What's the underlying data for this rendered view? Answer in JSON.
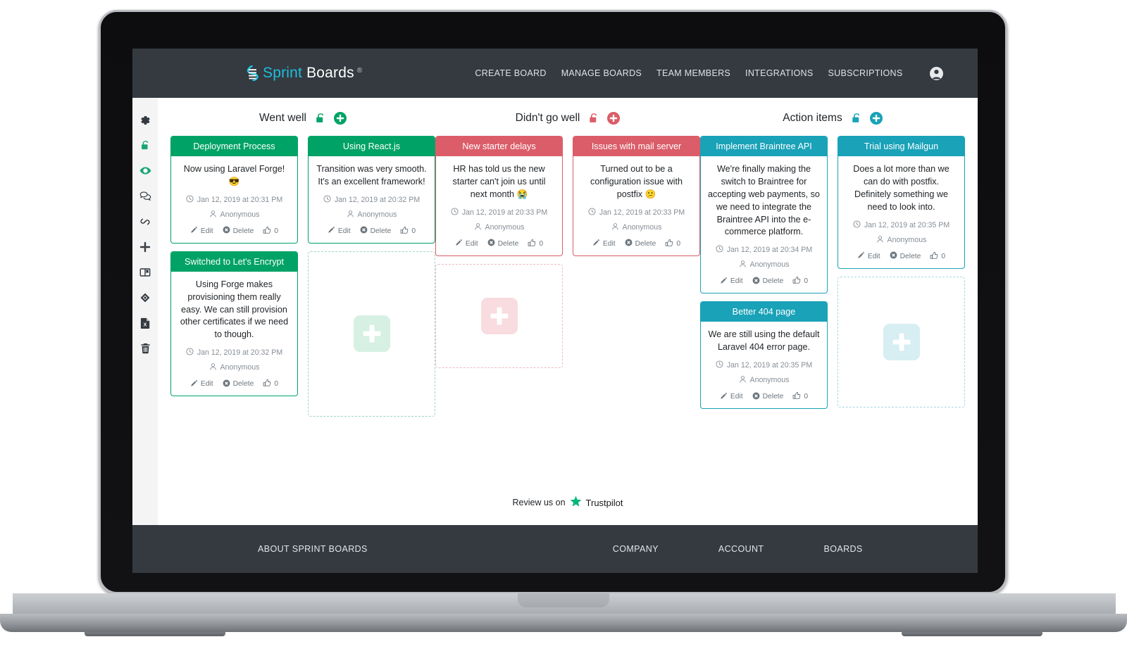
{
  "navbar": {
    "brand": {
      "sprint": "Sprint",
      "boards": "Boards",
      "registered": "®"
    },
    "links": [
      {
        "label": "CREATE BOARD",
        "name": "nav-create-board"
      },
      {
        "label": "MANAGE BOARDS",
        "name": "nav-manage-boards"
      },
      {
        "label": "TEAM MEMBERS",
        "name": "nav-team-members"
      },
      {
        "label": "INTEGRATIONS",
        "name": "nav-integrations"
      },
      {
        "label": "SUBSCRIPTIONS",
        "name": "nav-subscriptions"
      }
    ],
    "avatar_icon": "user-circle-icon"
  },
  "sidebar": {
    "items": [
      {
        "icon": "gear-icon",
        "color": "#343a40"
      },
      {
        "icon": "unlock-icon",
        "color": "#17a673"
      },
      {
        "icon": "eye-icon",
        "color": "#17a673"
      },
      {
        "icon": "comments-icon",
        "color": "#343a40"
      },
      {
        "icon": "link-icon",
        "color": "#343a40"
      },
      {
        "icon": "slack-icon",
        "color": "#343a40"
      },
      {
        "icon": "book-icon",
        "color": "#343a40"
      },
      {
        "icon": "sketch-icon",
        "color": "#343a40"
      },
      {
        "icon": "file-excel-icon",
        "color": "#343a40"
      },
      {
        "icon": "trash-icon",
        "color": "#343a40"
      }
    ]
  },
  "colors": {
    "green": "#00a365",
    "green_border": "#00a365",
    "red": "#db5d69",
    "red_border": "#db5d69",
    "teal": "#19a2b8",
    "teal_border": "#19a2b8",
    "navy": "#343a40",
    "brand_cyan": "#20bedd"
  },
  "board": {
    "columns": [
      {
        "title": "Went well",
        "accent": "#00a365",
        "placeholder_fill": "#d6f0e4",
        "placeholder_border": "#9bd9c0",
        "lock_icon": "unlock-icon",
        "add_icon": "plus-circle-icon",
        "stacks": [
          {
            "cards": [
              {
                "title": "Deployment Process",
                "text": "Now using Laravel Forge! 😎",
                "time": "Jan 12, 2019 at 20:31 PM",
                "author": "Anonymous",
                "edit": "Edit",
                "delete": "Delete",
                "likes": "0"
              },
              {
                "title": "Switched to Let's Encrypt",
                "text": "Using Forge makes provisioning them really easy. We can still provision other certificates if we need to though.",
                "time": "Jan 12, 2019 at 20:32 PM",
                "author": "Anonymous",
                "edit": "Edit",
                "delete": "Delete",
                "likes": "0"
              }
            ],
            "placeholder": false
          },
          {
            "cards": [
              {
                "title": "Using React.js",
                "text": "Transition was very smooth. It's an excellent framework!",
                "time": "Jan 12, 2019 at 20:32 PM",
                "author": "Anonymous",
                "edit": "Edit",
                "delete": "Delete",
                "likes": "0"
              }
            ],
            "placeholder": true,
            "placeholder_height": 235
          }
        ]
      },
      {
        "title": "Didn't go well",
        "accent": "#db5d69",
        "placeholder_fill": "#f8dcdf",
        "placeholder_border": "#efb9bf",
        "lock_icon": "unlock-icon",
        "add_icon": "plus-circle-icon",
        "stacks": [
          {
            "cards": [
              {
                "title": "New starter delays",
                "text": "HR has told us the new starter can't join us until next month 😭",
                "time": "Jan 12, 2019 at 20:33 PM",
                "author": "Anonymous",
                "edit": "Edit",
                "delete": "Delete",
                "likes": "0"
              }
            ],
            "placeholder": true,
            "placeholder_height": 148
          },
          {
            "cards": [
              {
                "title": "Issues with mail server",
                "text": "Turned out to be a configuration issue with postfix 😕",
                "time": "Jan 12, 2019 at 20:33 PM",
                "author": "Anonymous",
                "edit": "Edit",
                "delete": "Delete",
                "likes": "0"
              }
            ],
            "placeholder": false
          }
        ]
      },
      {
        "title": "Action items",
        "accent": "#19a2b8",
        "placeholder_fill": "#d7eef3",
        "placeholder_border": "#a6d8e2",
        "lock_icon": "unlock-icon",
        "add_icon": "plus-circle-icon",
        "stacks": [
          {
            "cards": [
              {
                "title": "Implement Braintree API",
                "text": "We're finally making the switch to Braintree for accepting web payments, so we need to integrate the Braintree API into the e-commerce platform.",
                "time": "Jan 12, 2019 at 20:34 PM",
                "author": "Anonymous",
                "edit": "Edit",
                "delete": "Delete",
                "likes": "0"
              },
              {
                "title": "Better 404 page",
                "text": "We are still using the default Laravel 404 error page.",
                "time": "Jan 12, 2019 at 20:35 PM",
                "author": "Anonymous",
                "edit": "Edit",
                "delete": "Delete",
                "likes": "0"
              }
            ],
            "placeholder": false
          },
          {
            "cards": [
              {
                "title": "Trial using Mailgun",
                "text": "Does a lot more than we can do with postfix. Definitely something we need to look into.",
                "time": "Jan 12, 2019 at 20:35 PM",
                "author": "Anonymous",
                "edit": "Edit",
                "delete": "Delete",
                "likes": "0"
              }
            ],
            "placeholder": true,
            "placeholder_height": 186
          }
        ]
      }
    ]
  },
  "trustpilot": {
    "prefix": "Review us on",
    "name": "Trustpilot",
    "star_color": "#00b67a",
    "star_icon": "star-icon"
  },
  "footer": {
    "links": [
      {
        "label": "ABOUT SPRINT BOARDS",
        "name": "footer-about-sprint-boards"
      },
      {
        "label": "COMPANY",
        "name": "footer-company"
      },
      {
        "label": "ACCOUNT",
        "name": "footer-account"
      },
      {
        "label": "BOARDS",
        "name": "footer-boards"
      }
    ]
  }
}
